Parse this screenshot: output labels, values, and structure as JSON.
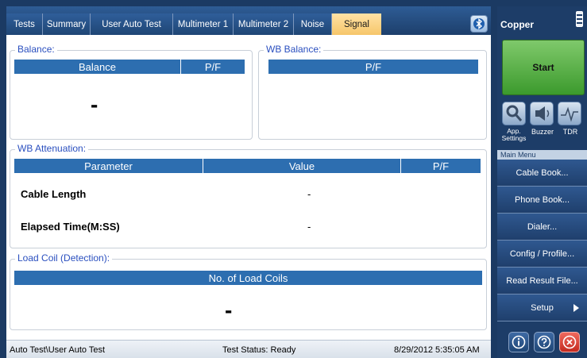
{
  "tabs": [
    {
      "label": "Tests"
    },
    {
      "label": "Summary"
    },
    {
      "label": "User Auto Test"
    },
    {
      "label": "Multimeter 1"
    },
    {
      "label": "Multimeter 2"
    },
    {
      "label": "Noise"
    },
    {
      "label": "Signal",
      "active": true
    }
  ],
  "balance": {
    "title": "Balance:",
    "col_balance": "Balance",
    "col_pf": "P/F",
    "value": "-"
  },
  "wb_balance": {
    "title": "WB Balance:",
    "col_pf": "P/F"
  },
  "wb_attenuation": {
    "title": "WB Attenuation:",
    "col_parameter": "Parameter",
    "col_value": "Value",
    "col_pf": "P/F",
    "rows": [
      {
        "parameter": "Cable Length",
        "value": "-"
      },
      {
        "parameter": "Elapsed Time(M:SS)",
        "value": "-"
      }
    ]
  },
  "load_coil": {
    "title": "Load Coil (Detection):",
    "col_count": "No. of Load Coils",
    "value": "-"
  },
  "status_bar": {
    "path": "Auto Test\\User Auto Test",
    "status": "Test Status: Ready",
    "datetime": "8/29/2012 5:35:05 AM"
  },
  "side": {
    "title": "Copper",
    "start_label": "Start",
    "quick_buttons": [
      {
        "label": "App. Settings",
        "icon": "wrench-icon"
      },
      {
        "label": "Buzzer",
        "icon": "speaker-icon"
      },
      {
        "label": "TDR",
        "icon": "waveform-icon"
      }
    ],
    "menu_title": "Main Menu",
    "menu": [
      {
        "label": "Cable Book..."
      },
      {
        "label": "Phone Book..."
      },
      {
        "label": "Dialer..."
      },
      {
        "label": "Config / Profile..."
      },
      {
        "label": "Read Result File..."
      },
      {
        "label": "Setup"
      }
    ]
  },
  "colors": {
    "accent_header": "#2d6eb0",
    "tab_active": "#f6c66a",
    "start_green": "#3c9a2d",
    "close_red": "#d9342b"
  }
}
